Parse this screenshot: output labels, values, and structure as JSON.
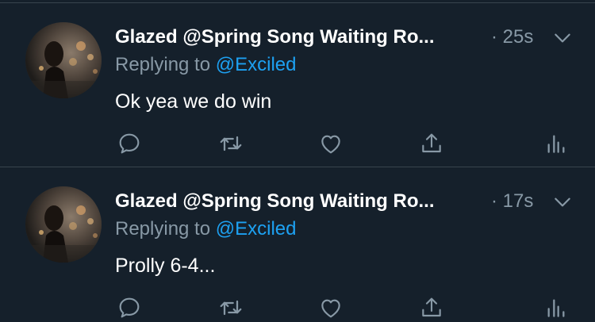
{
  "colors": {
    "background": "#15202b",
    "divider": "#38444d",
    "text_primary": "#ffffff",
    "text_secondary": "#8899a6",
    "accent": "#1da1f2"
  },
  "tweets": [
    {
      "author": "Glazed @Spring Song Waiting Ro...",
      "time": "· 25s",
      "replying_prefix": "Replying to",
      "replying_handle": "@Exciled",
      "text": "Ok yea we do win",
      "avatar_icon": "avatar-photo",
      "actions": [
        "reply-icon",
        "retweet-icon",
        "like-icon",
        "share-icon",
        "analytics-icon"
      ]
    },
    {
      "author": "Glazed @Spring Song Waiting Ro...",
      "time": "· 17s",
      "replying_prefix": "Replying to",
      "replying_handle": "@Exciled",
      "text": "Prolly 6-4...",
      "avatar_icon": "avatar-photo",
      "actions": [
        "reply-icon",
        "retweet-icon",
        "like-icon",
        "share-icon",
        "analytics-icon"
      ]
    }
  ]
}
